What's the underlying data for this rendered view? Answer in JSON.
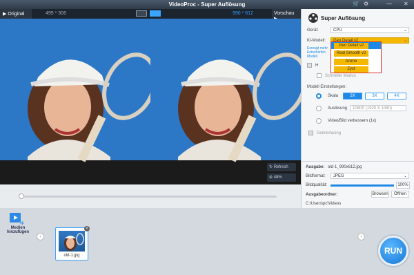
{
  "titlebar": {
    "title": "VideoProc - Super Auflösung",
    "controls": [
      "🛒",
      "⚙",
      "—",
      "✕"
    ]
  },
  "viewer": {
    "original_label": "Original",
    "original_dims": "495 * 306",
    "output_dims": "990 * 612",
    "preview_label": "Vorschau",
    "refresh_label": "Refresh",
    "zoom_label": "48%"
  },
  "panel": {
    "title": "Super Auflösung",
    "geraet_label": "Gerät:",
    "geraet_value": "CPU",
    "model_label": "KI-Modell:",
    "model_value": "Gen Detail v2",
    "model_desc": "Erzeugt mehr\nEntschärfen\nModell.",
    "dropdown_options": [
      "Gen Detail v2",
      "Real Smooth v2",
      "Anime",
      "Zyxt"
    ],
    "hidden_row1": "H",
    "hidden_row2": "Schneller Modus",
    "settings_label": "Modell Einstellungen:",
    "scale_label": "Skala",
    "scale_options": [
      "2X",
      "3X",
      "4X"
    ],
    "resolution_label": "Auslösung",
    "resolution_value": "1080P (1920 X 1080)",
    "enhance_label": "Video/Bild verbessern (1x)",
    "deinterlace_label": "Deinterlacing",
    "output_label": "Ausgabe:",
    "output_value": "old-1_990x612.jpg",
    "format_label": "Bildformat:",
    "format_value": "JPEG",
    "quality_label": "Bildqualität:",
    "quality_value": "100%",
    "quality_fraction": 1.0,
    "folder_label": "Ausgabeordner:",
    "browse_label": "Browsen",
    "open_label": "Öffnen",
    "folder_path": "C:\\Users\\pc\\Videos"
  },
  "bottom": {
    "add_media_label": "Medien\nhinzufügen",
    "thumb_name": "old-1.jpg",
    "run_label": "RUN",
    "nav_left": "‹",
    "nav_right": "›"
  },
  "colors": {
    "accent": "#1e88e5",
    "dropdown_highlight": "#f5b800",
    "dropdown_border": "#e03030"
  }
}
